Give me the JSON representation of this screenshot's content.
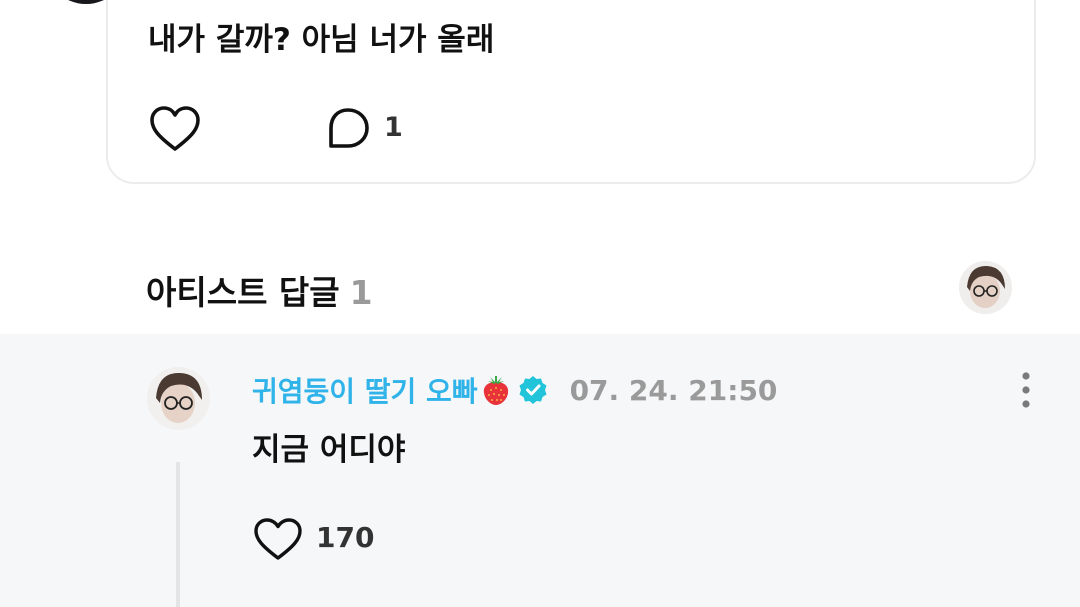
{
  "post": {
    "text": "내가 갈까? 아님 너가 올래",
    "comment_count": "1",
    "icons": {
      "like": "heart-outline-icon",
      "comment": "speech-bubble-icon"
    }
  },
  "artist_replies": {
    "title": "아티스트 답글",
    "count": "1"
  },
  "reply": {
    "author": "귀염둥이 딸기 오빠",
    "author_emoji": "strawberry-icon",
    "verified": "verified-badge-icon",
    "timestamp": "07. 24. 21:50",
    "text": "지금 어디야",
    "like_count": "170"
  },
  "colors": {
    "author_name": "#2fb3e9",
    "verified_badge": "#21c4d9",
    "muted_text": "#9a9a9a",
    "reply_background": "#f6f7f8",
    "card_border": "#ececec"
  }
}
